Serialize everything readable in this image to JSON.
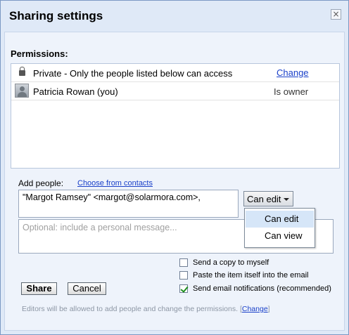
{
  "dialog": {
    "title": "Sharing settings",
    "close_label": "×"
  },
  "permissions": {
    "label": "Permissions:",
    "rows": [
      {
        "icon": "lock-icon",
        "text": "Private - Only the people listed below can access",
        "action": "Change"
      },
      {
        "icon": "avatar",
        "text": "Patricia Rowan (you)",
        "role": "Is owner"
      }
    ]
  },
  "add_people": {
    "label": "Add people:",
    "choose_link": "Choose from contacts",
    "value": "\"Margot Ramsey\" <margot@solarmora.com>,",
    "role_selected": "Can edit",
    "role_options": [
      "Can edit",
      "Can view"
    ],
    "highlighted_option": "Can edit"
  },
  "message": {
    "placeholder": "Optional: include a personal message..."
  },
  "options": [
    {
      "label": "Send a copy to myself",
      "checked": false
    },
    {
      "label": "Paste the item itself into the email",
      "checked": false
    },
    {
      "label": "Send email notifications (recommended)",
      "checked": true
    }
  ],
  "buttons": {
    "share": "Share",
    "cancel": "Cancel"
  },
  "footer": {
    "note": "Editors will be allowed to add people and change the permissions.",
    "bracket_open": "[",
    "link": "Change",
    "bracket_close": "]"
  },
  "colors": {
    "link": "#1a40c9",
    "dialog_bg": "#dfe9f7",
    "check": "#1d8f1d",
    "highlight": "#d6e6f8"
  }
}
